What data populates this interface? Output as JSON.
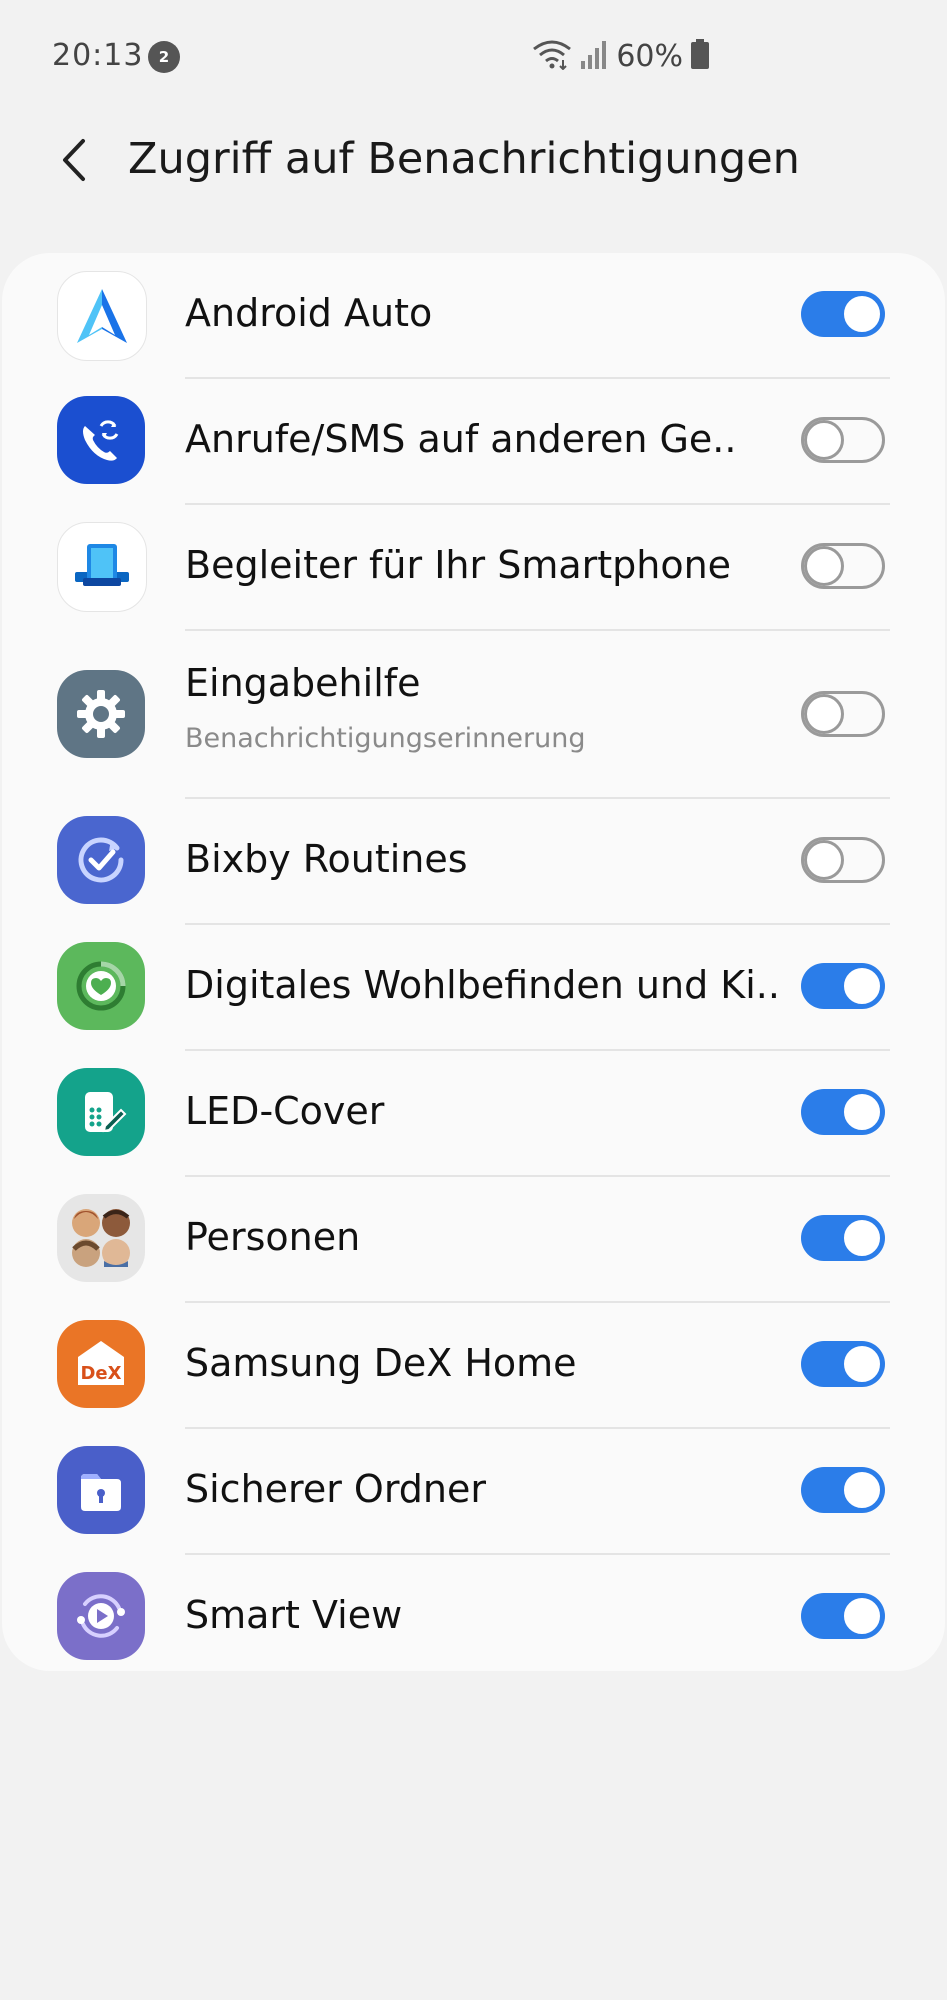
{
  "status_bar": {
    "time": "20:13",
    "notification_count": "2",
    "battery": "60%"
  },
  "header": {
    "title": "Zugriff auf Benachrichtigungen"
  },
  "apps": [
    {
      "name": "Android Auto",
      "icon": "android-auto-icon",
      "enabled": true
    },
    {
      "name": "Anrufe/SMS auf anderen Ge..",
      "icon": "call-sync-icon",
      "enabled": false
    },
    {
      "name": "Begleiter für Ihr Smartphone",
      "icon": "phone-companion-icon",
      "enabled": false
    },
    {
      "name": "Eingabehilfe",
      "subtitle": "Benachrichtigungserinnerung",
      "icon": "gear-icon",
      "enabled": false
    },
    {
      "name": "Bixby Routines",
      "icon": "bixby-routines-icon",
      "enabled": false
    },
    {
      "name": "Digitales Wohlbefinden und Ki..",
      "icon": "digital-wellbeing-icon",
      "enabled": true
    },
    {
      "name": "LED-Cover",
      "icon": "led-cover-icon",
      "enabled": true
    },
    {
      "name": "Personen",
      "icon": "contacts-people-icon",
      "enabled": true
    },
    {
      "name": "Samsung DeX Home",
      "icon": "dex-icon",
      "icon_text": "DeX",
      "enabled": true
    },
    {
      "name": "Sicherer Ordner",
      "icon": "secure-folder-icon",
      "enabled": true
    },
    {
      "name": "Smart View",
      "icon": "smart-view-icon",
      "enabled": true
    }
  ],
  "colors": {
    "toggle_on": "#2b7de9",
    "background": "#f2f2f2",
    "card": "#fafafa"
  }
}
